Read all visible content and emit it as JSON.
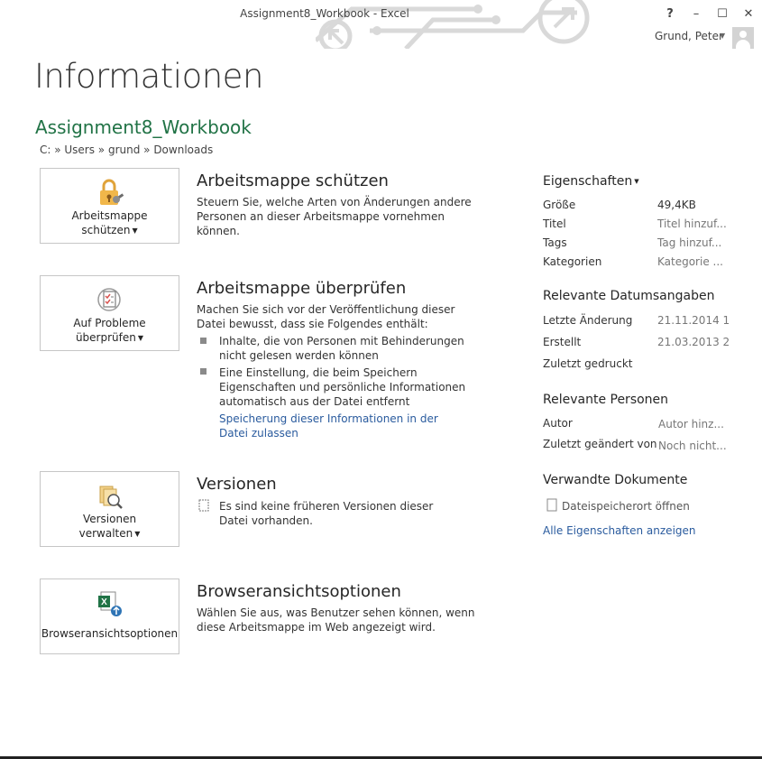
{
  "window": {
    "title": "Assignment8_Workbook - Excel",
    "help": "?",
    "minimize": "–",
    "maximize": "☐",
    "close": "✕",
    "user": "Grund, Peter"
  },
  "page": {
    "title": "Informationen",
    "doc_name": "Assignment8_Workbook",
    "path": "C: » Users » grund » Downloads"
  },
  "sections": {
    "protect": {
      "button_line1": "Arbeitsmappe",
      "button_line2": "schützen",
      "title": "Arbeitsmappe schützen",
      "text": "Steuern Sie, welche Arten von Änderungen andere Personen an dieser Arbeitsmappe vornehmen können."
    },
    "inspect": {
      "button_line1": "Auf Probleme",
      "button_line2": "überprüfen",
      "title": "Arbeitsmappe überprüfen",
      "text": "Machen Sie sich vor der Veröffentlichung dieser Datei bewusst, dass sie Folgendes enthält:",
      "bullets": [
        "Inhalte, die von Personen mit Behinderungen nicht gelesen werden können",
        "Eine Einstellung, die beim Speichern Eigenschaften und persönliche Informationen automatisch aus der Datei entfernt"
      ],
      "link": "Speicherung dieser Informationen in der Datei zulassen"
    },
    "versions": {
      "button_line1": "Versionen",
      "button_line2": "verwalten",
      "title": "Versionen",
      "text": "Es sind keine früheren Versionen dieser Datei vorhanden."
    },
    "browser": {
      "button_label": "Browseransichtsoptionen",
      "title": "Browseransichtsoptionen",
      "text": "Wählen Sie aus, was Benutzer sehen können, wenn diese Arbeitsmappe im Web angezeigt wird."
    }
  },
  "properties": {
    "heading": "Eigenschaften",
    "rows": [
      {
        "label": "Größe",
        "value": "49,4KB"
      },
      {
        "label": "Titel",
        "value": "Titel hinzuf..."
      },
      {
        "label": "Tags",
        "value": "Tag hinzuf..."
      },
      {
        "label": "Kategorien",
        "value": "Kategorie ..."
      }
    ],
    "dates_heading": "Relevante Datumsangaben",
    "dates": [
      {
        "label": "Letzte Änderung",
        "value": "21.11.2014 1..."
      },
      {
        "label": "Erstellt",
        "value": "21.03.2013 2..."
      },
      {
        "label": "Zuletzt gedruckt",
        "value": ""
      }
    ],
    "people_heading": "Relevante Personen",
    "people": [
      {
        "label": "Autor",
        "value": "Autor hinz..."
      },
      {
        "label": "Zuletzt geändert von",
        "value": "Noch nicht..."
      }
    ],
    "related_heading": "Verwandte Dokumente",
    "open_location": "Dateispeicherort öffnen",
    "show_all": "Alle Eigenschaften anzeigen"
  },
  "colors": {
    "accent_green": "#217346",
    "link_blue": "#2a5b9e"
  }
}
